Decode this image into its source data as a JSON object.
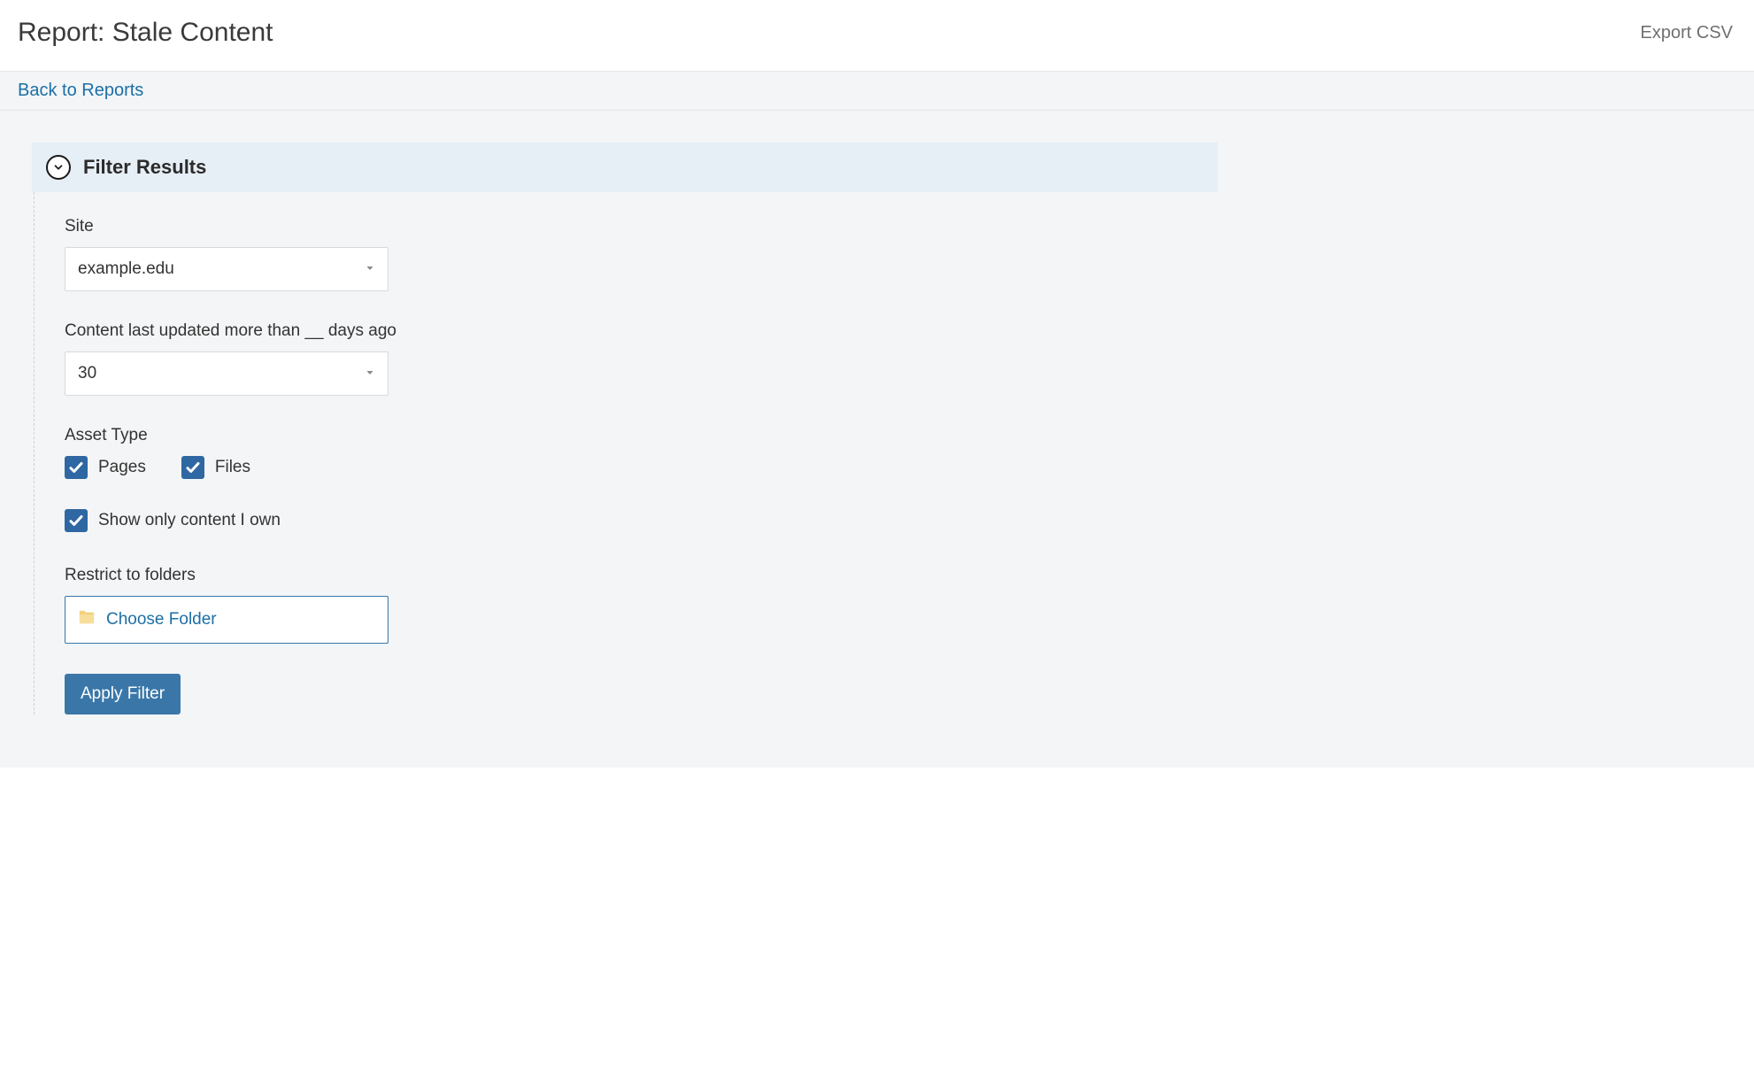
{
  "header": {
    "title": "Report: Stale Content",
    "export_csv": "Export CSV"
  },
  "breadcrumb": {
    "back_link": "Back to Reports"
  },
  "filter": {
    "title": "Filter Results",
    "site": {
      "label": "Site",
      "value": "example.edu"
    },
    "days": {
      "label": "Content last updated more than __ days ago",
      "value": "30"
    },
    "asset_type": {
      "label": "Asset Type",
      "pages": {
        "label": "Pages",
        "checked": true
      },
      "files": {
        "label": "Files",
        "checked": true
      }
    },
    "show_only_own": {
      "label": "Show only content I own",
      "checked": true
    },
    "restrict_folders": {
      "label": "Restrict to folders",
      "button_label": "Choose Folder"
    },
    "apply_button": "Apply Filter"
  }
}
